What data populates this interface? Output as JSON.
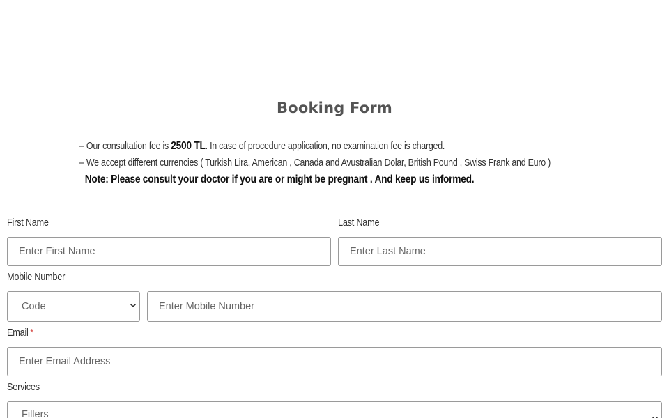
{
  "form": {
    "title": "Booking Form",
    "info": {
      "line1_prefix": "– Our consultation fee is ",
      "line1_fee": "2500 TL",
      "line1_suffix": ". In case of procedure application, no examination fee is charged.",
      "line2": "– We accept different currencies ( Turkish Lira, American , Canada and Avustralian Dolar, British Pound , Swiss Frank and Euro )",
      "note": "Note: Please consult your doctor if you are or might be pregnant . And keep us informed."
    },
    "first_name": {
      "label": "First Name",
      "placeholder": "Enter First Name",
      "value": ""
    },
    "last_name": {
      "label": "Last Name",
      "placeholder": "Enter Last Name",
      "value": ""
    },
    "mobile": {
      "label": "Mobile Number",
      "code_selected": "Code",
      "placeholder": "Enter Mobile Number",
      "value": ""
    },
    "email": {
      "label": "Email",
      "required_mark": "*",
      "placeholder": "Enter Email Address",
      "value": ""
    },
    "services": {
      "label": "Services",
      "selected": "Fillers"
    }
  },
  "colors": {
    "border": "#9a9a9a",
    "required": "#d9534f",
    "title": "#545454",
    "text": "#333333",
    "placeholder": "#666666"
  },
  "icons": {
    "select_chevron": "chevron-down-icon"
  }
}
